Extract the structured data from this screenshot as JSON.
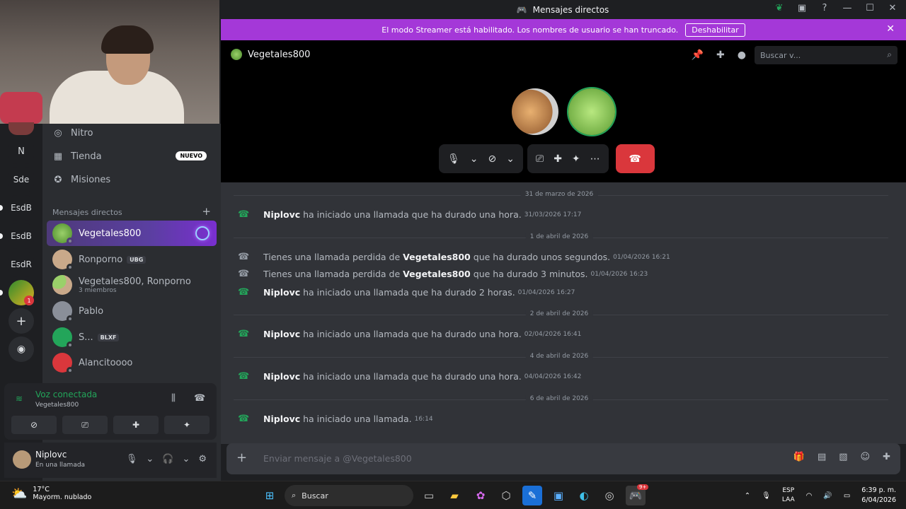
{
  "window": {
    "title": "Mensajes directos"
  },
  "banner": {
    "text": "El modo Streamer está habilitado. Los nombres de usuario se han truncado.",
    "button": "Deshabilitar"
  },
  "servers": [
    {
      "label": "N"
    },
    {
      "label": "Sde"
    },
    {
      "label": "EsdB"
    },
    {
      "label": "EsdB"
    },
    {
      "label": "EsdR"
    }
  ],
  "server_badge": "1",
  "nav": {
    "nitro": "Nitro",
    "tienda": "Tienda",
    "tienda_badge": "NUEVO",
    "misiones": "Misiones"
  },
  "dm_header": "Mensajes directos",
  "dms": [
    {
      "name": "Vegetales800"
    },
    {
      "name": "Ronporno",
      "tag": "UBG"
    },
    {
      "name": "Vegetales800, Ronporno",
      "sub": "3 miembros"
    },
    {
      "name": "Pablo"
    },
    {
      "name": "S...",
      "tag": "BLXF"
    },
    {
      "name": "Alancitoooo"
    }
  ],
  "voice": {
    "status": "Voz conectada",
    "channel": "Vegetales800"
  },
  "user": {
    "name": "Niplovc",
    "status": "En una llamada"
  },
  "call": {
    "name": "Vegetales800",
    "search_placeholder": "Buscar v..."
  },
  "messages": [
    {
      "type": "date",
      "text": "31 de marzo de 2026"
    },
    {
      "type": "call",
      "user": "Niplovc",
      "text": "ha iniciado una llamada que ha durado una hora.",
      "ts": "31/03/2026 17:17"
    },
    {
      "type": "date",
      "text": "1 de abril de 2026"
    },
    {
      "type": "missed",
      "pre": "Tienes una llamada perdida de",
      "user": "Vegetales800",
      "text": "que ha durado unos segundos.",
      "ts": "01/04/2026 16:21"
    },
    {
      "type": "missed",
      "pre": "Tienes una llamada perdida de",
      "user": "Vegetales800",
      "text": "que ha durado 3 minutos.",
      "ts": "01/04/2026 16:23"
    },
    {
      "type": "call",
      "user": "Niplovc",
      "text": "ha iniciado una llamada que ha durado 2 horas.",
      "ts": "01/04/2026 16:27"
    },
    {
      "type": "date",
      "text": "2 de abril de 2026"
    },
    {
      "type": "call",
      "user": "Niplovc",
      "text": "ha iniciado una llamada que ha durado una hora.",
      "ts": "02/04/2026 16:41"
    },
    {
      "type": "date",
      "text": "4 de abril de 2026"
    },
    {
      "type": "call",
      "user": "Niplovc",
      "text": "ha iniciado una llamada que ha durado una hora.",
      "ts": "04/04/2026 16:42"
    },
    {
      "type": "date",
      "text": "6 de abril de 2026"
    },
    {
      "type": "call",
      "user": "Niplovc",
      "text": "ha iniciado una llamada.",
      "ts": "16:14"
    }
  ],
  "composer": {
    "placeholder": "Enviar mensaje a @Vegetales800"
  },
  "taskbar": {
    "temp": "17°C",
    "weather": "Mayorm. nublado",
    "search": "Buscar",
    "lang1": "ESP",
    "lang2": "LAA",
    "time": "6:39 p. m.",
    "date": "6/04/2026",
    "discord_badge": "9+"
  }
}
